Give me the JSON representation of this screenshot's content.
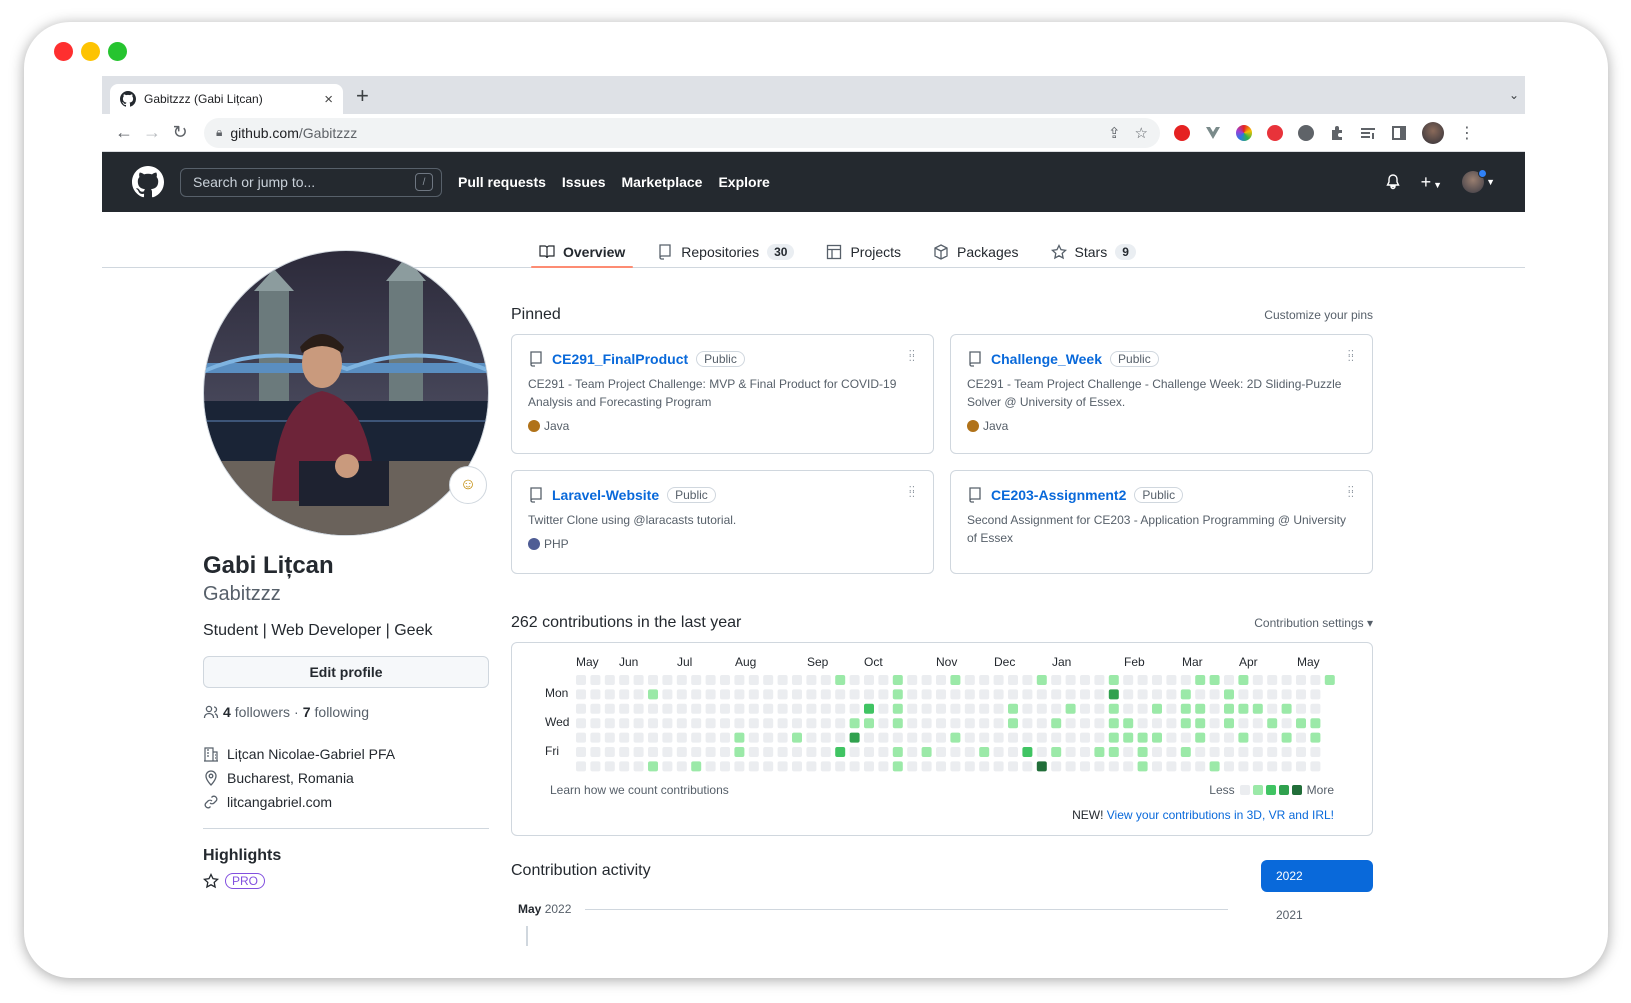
{
  "browser": {
    "tab_title": "Gabitzzz (Gabi Lițcan)",
    "tab_close": "×",
    "new_tab": "+",
    "url_host": "github.com",
    "url_path": "/Gabitzzz"
  },
  "header": {
    "search_placeholder": "Search or jump to...",
    "search_shortcut": "/",
    "nav": [
      "Pull requests",
      "Issues",
      "Marketplace",
      "Explore"
    ]
  },
  "tabs": [
    {
      "label": "Overview",
      "icon": "book-icon",
      "active": true
    },
    {
      "label": "Repositories",
      "icon": "repo-icon",
      "count": "30"
    },
    {
      "label": "Projects",
      "icon": "table-icon"
    },
    {
      "label": "Packages",
      "icon": "package-icon"
    },
    {
      "label": "Stars",
      "icon": "star-icon",
      "count": "9"
    }
  ],
  "profile": {
    "name": "Gabi Lițcan",
    "login": "Gabitzzz",
    "bio": "Student | Web Developer | Geek",
    "edit_label": "Edit profile",
    "followers_count": "4",
    "followers_label": "followers",
    "separator": "·",
    "following_count": "7",
    "following_label": "following",
    "company": "Lițcan Nicolae-Gabriel PFA",
    "location": "Bucharest, Romania",
    "website": "litcangabriel.com",
    "highlights_title": "Highlights",
    "pro_badge": "PRO"
  },
  "pinned": {
    "title": "Pinned",
    "customize": "Customize your pins",
    "public_label": "Public",
    "repos": [
      {
        "name": "CE291_FinalProduct",
        "description": "CE291 - Team Project Challenge: MVP & Final Product for COVID-19 Analysis and Forecasting Program",
        "language": "Java",
        "lang_color": "#b07219"
      },
      {
        "name": "Challenge_Week",
        "description": "CE291 - Team Project Challenge - Challenge Week: 2D Sliding-Puzzle Solver @ University of Essex.",
        "language": "Java",
        "lang_color": "#b07219"
      },
      {
        "name": "Laravel-Website",
        "description": "Twitter Clone using @laracasts tutorial.",
        "language": "PHP",
        "lang_color": "#4F5D95"
      },
      {
        "name": "CE203-Assignment2",
        "description": "Second Assignment for CE203 - Application Programming @ University of Essex",
        "language": "",
        "lang_color": ""
      }
    ]
  },
  "contributions": {
    "title": "262 contributions in the last year",
    "settings": "Contribution settings ▾",
    "months": [
      "May",
      "Jun",
      "Jul",
      "Aug",
      "Sep",
      "Oct",
      "Nov",
      "Dec",
      "Jan",
      "Feb",
      "Mar",
      "Apr",
      "May"
    ],
    "day_labels": [
      "Mon",
      "Wed",
      "Fri"
    ],
    "learn": "Learn how we count contributions",
    "less": "Less",
    "more": "More",
    "new_prefix": "NEW!",
    "new_link": "View your contributions in 3D, VR and IRL!",
    "colors": [
      "#ebedf0",
      "#9be9a8",
      "#40c463",
      "#30a14e",
      "#216e39"
    ]
  },
  "activity": {
    "title": "Contribution activity",
    "month": "May",
    "year_label": "2022",
    "years": [
      "2022",
      "2021"
    ]
  }
}
